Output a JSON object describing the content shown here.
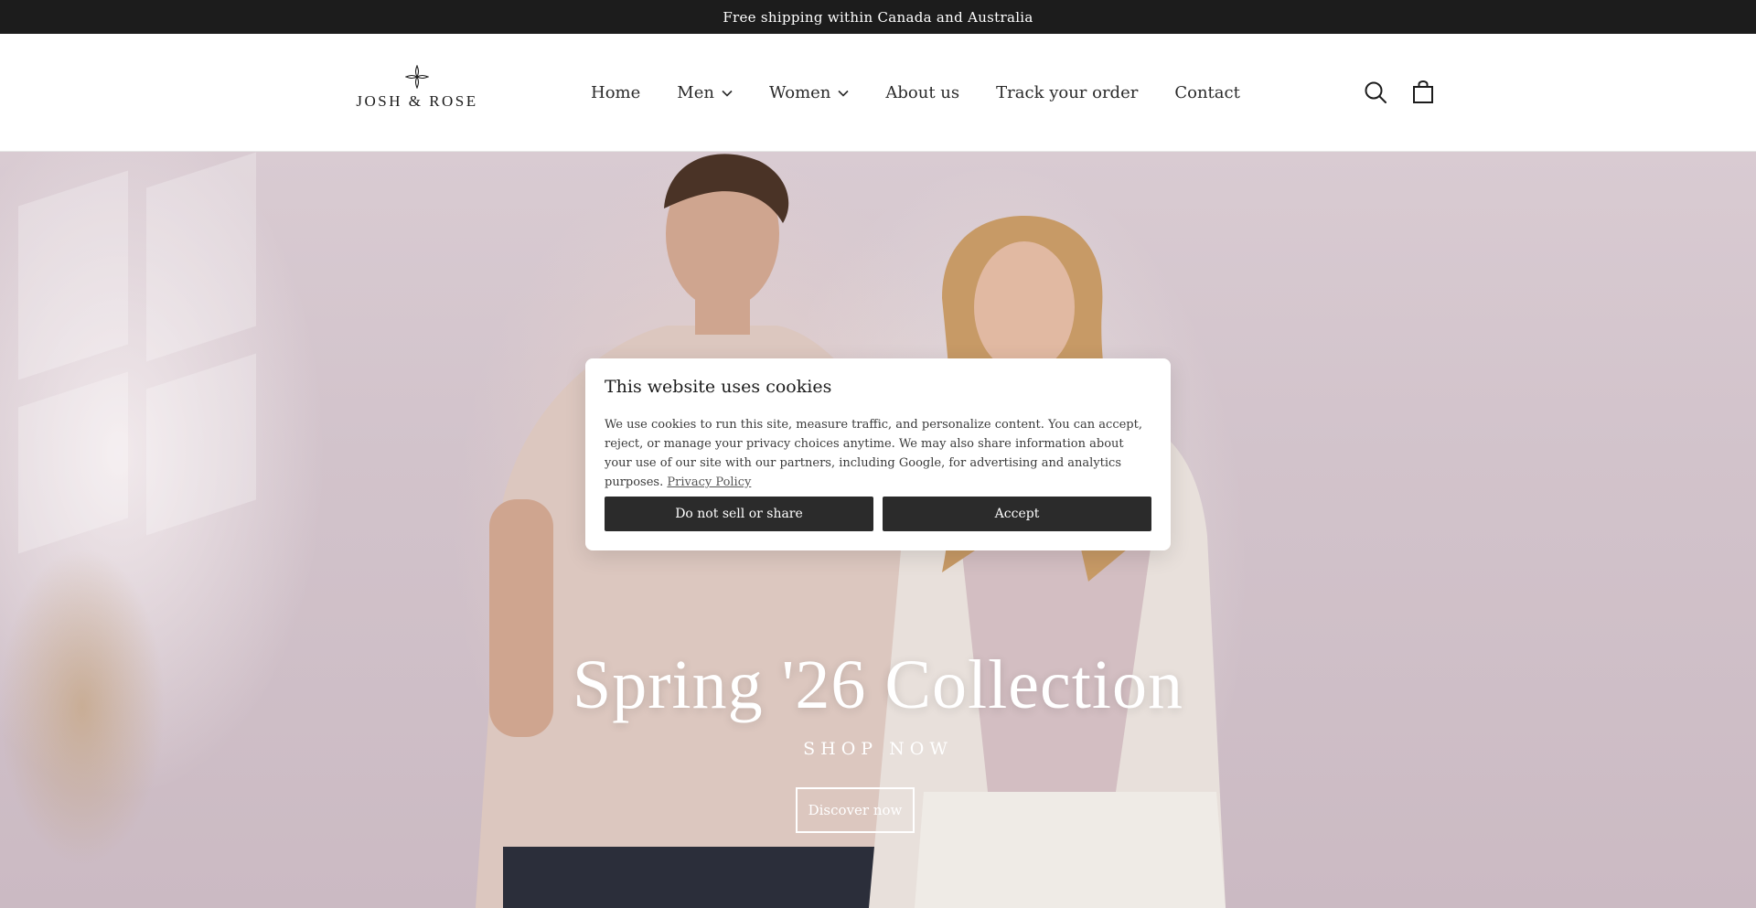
{
  "announcement": {
    "text": "Free shipping within Canada and Australia"
  },
  "brand": {
    "name": "JOSH & ROSE"
  },
  "nav": {
    "items": [
      {
        "label": "Home"
      },
      {
        "label": "Men"
      },
      {
        "label": "Women"
      },
      {
        "label": "About us"
      },
      {
        "label": "Track your order"
      },
      {
        "label": "Contact"
      }
    ]
  },
  "header_icons": [
    "search-icon",
    "cart-icon"
  ],
  "hero": {
    "title": "Spring '26 Collection",
    "subtitle": "SHOP NOW",
    "button_label": "Discover now"
  },
  "cookie": {
    "title": "This website uses cookies",
    "text": "We use cookies to run this site, measure traffic, and personalize content. You can accept, reject, or manage your privacy choices anytime. We may also share information about your use of our site with our partners, including Google, for advertising and analytics purposes.",
    "link_label": "Privacy Policy",
    "reject_label": "Do not sell or share",
    "accept_label": "Accept"
  },
  "colors": {
    "announcement_bg": "#1c1c1c",
    "button_dark": "#2b2b2b",
    "hero_bg": "#d4c5cc"
  }
}
